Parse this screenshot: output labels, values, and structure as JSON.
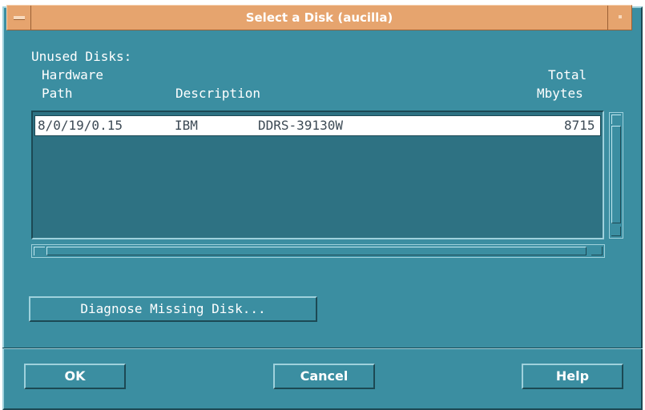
{
  "window": {
    "title": "Select a Disk (aucilla)"
  },
  "section": {
    "label": "Unused Disks:"
  },
  "columns": {
    "path": [
      "Hardware",
      "Path"
    ],
    "description": "Description",
    "mbytes": [
      "Total",
      "Mbytes"
    ]
  },
  "disks": [
    {
      "path": "8/0/19/0.15",
      "vendor": "IBM",
      "model": "DDRS-39130W",
      "mbytes": "8715"
    }
  ],
  "buttons": {
    "diagnose": "Diagnose Missing Disk...",
    "ok": "OK",
    "cancel": "Cancel",
    "help": "Help"
  },
  "colors": {
    "background": "#3b8ea1",
    "titlebar": "#e6a46e",
    "list_background": "#2e7283",
    "selected_row": "#ffffff"
  }
}
